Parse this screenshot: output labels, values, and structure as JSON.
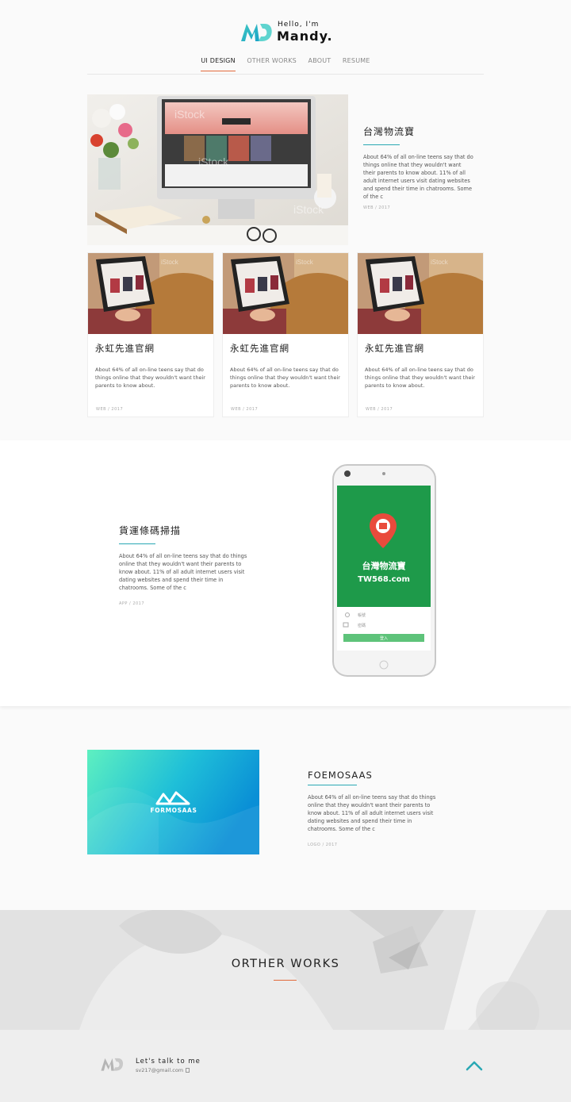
{
  "header": {
    "hello": "Hello, I'm",
    "name": "Mandy.",
    "nav": [
      "UI DESIGN",
      "OTHER WORKS",
      "ABOUT",
      "RESUME"
    ]
  },
  "featured": {
    "title": "台灣物流寶",
    "desc": "About 64% of all on-line teens say that do things online that they wouldn't want their parents to know about.   11% of all adult internet users visit dating websites and spend their time in chatrooms. Some of the c",
    "meta": "WEB / 2017",
    "watermark": "iStock"
  },
  "cards": [
    {
      "title": "永虹先進官網",
      "desc": "About 64% of all on-line teens say that do things online that they wouldn't want their parents to know about.",
      "meta": "WEB / 2017"
    },
    {
      "title": "永虹先進官網",
      "desc": "About 64% of all on-line teens say that do things online that they wouldn't want their parents to know about.",
      "meta": "WEB / 2017"
    },
    {
      "title": "永虹先進官網",
      "desc": "About 64% of all on-line teens say that do things online that they wouldn't want their parents to know about.",
      "meta": "WEB / 2017"
    }
  ],
  "app": {
    "title": "貨運條碼掃描",
    "desc": "About 64% of all on-line teens say that do things online that they wouldn't want their parents to know about.   11% of all adult internet users visit dating websites and spend their time in chatrooms. Some of the c",
    "meta": "APP / 2017",
    "screen_brand": "台灣物流寶",
    "screen_url": "TW568.com",
    "field_account": "帳號",
    "field_password": "密碼",
    "login_label": "登入",
    "screen_color": "#1e9a4a"
  },
  "brand": {
    "title": "FOEMOSAAS",
    "desc": "About 64% of all on-line teens say that do things online that they wouldn't want their parents to know about.   11% of all adult internet users visit dating websites and spend their time in chatrooms. Some of the c",
    "meta": "LOGO / 2017",
    "logo_text": "FORMOSAAS"
  },
  "banner": {
    "title": "ORTHER WORKS"
  },
  "footer": {
    "talk": "Let's talk to me",
    "email": "sv217@gmail.com"
  },
  "colors": {
    "accent": "#e26a3c",
    "teal": "#2aa8b4"
  },
  "icons": [
    "md-logo-icon",
    "copy-icon",
    "back-to-top-chevron-icon",
    "user-icon",
    "lock-icon",
    "location-pin-icon"
  ]
}
